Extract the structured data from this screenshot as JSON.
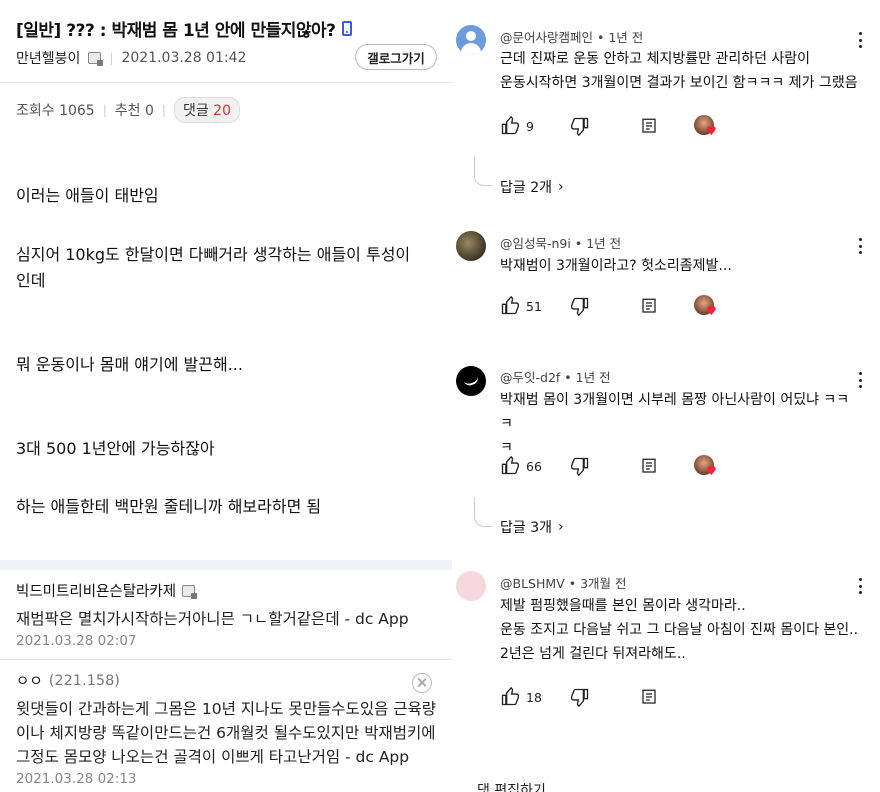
{
  "post": {
    "title": "[일반] ??? : 박재범 몸 1년 안에 만들지않아?",
    "author": "만년헬붕이",
    "date": "2021.03.28 01:42",
    "gallery_button": "갤로그가기",
    "views_label": "조회수 1065",
    "recommend_label": "추천 0",
    "replies_label": "댓글",
    "replies_count": "20",
    "body": [
      "이러는 애들이 태반임",
      "심지어 10kg도 한달이면 다빼거라 생각하는 애들이 투성이",
      "인데",
      "뭐 운동이나 몸매 얘기에 발끈해...",
      "3대 500 1년안에 가능하잖아",
      "하는 애들한테 백만원 줄테니까 해보라하면 됨"
    ]
  },
  "comments": [
    {
      "nick": "빅드미트리비욘슨탈라카제",
      "text": "재범팍은 멸치가시작하는거아니믄 ㄱㄴ할거같은데 - dc App",
      "date": "2021.03.28 02:07"
    },
    {
      "nick": "ㅇㅇ",
      "ip": "(221.158)",
      "text_lines": [
        "윗댓들이 간과하는게 그몸은 10년 지나도 못만들수도있음 근육량",
        "이나 체지방량 똑같이만드는건 6개월컷 될수도있지만 박재범키에",
        "그정도 몸모양 나오는건 골격이 이쁘게 타고난거임 - dc App"
      ],
      "date": "2021.03.28 02:13"
    }
  ],
  "yt_comments": [
    {
      "handle": "@문어사랑캠페인",
      "time": "1년 전",
      "lines": [
        "근데 진짜로 운동 안하고 체지방률만 관리하던 사람이",
        "운동시작하면 3개월이면 결과가 보이긴 함ㅋㅋㅋ 제가 그랬음"
      ],
      "likes": "9",
      "replies_link": "답글 2개"
    },
    {
      "handle": "@임성묵-n9i",
      "time": "1년 전",
      "lines": [
        "박재범이 3개월이라고? 헛소리좀제발..."
      ],
      "likes": "51"
    },
    {
      "handle": "@두잇-d2f",
      "time": "1년 전",
      "lines": [
        "박재범 몸이 3개월이면 시부레 몸짱 아닌사람이 어딨냐 ㅋㅋㅋ",
        "ㅋ"
      ],
      "likes": "66",
      "replies_link": "답글 3개"
    },
    {
      "handle": "@BLSHMV",
      "time": "3개월 전",
      "lines": [
        "제발 펌핑했을때를 본인 몸이라 생각마라..",
        "운동 조지고 다음날 쉬고 그 다음날 아침이 진짜 몸이다 본인..",
        "2년은 넘게 걸린다 뒤져라해도.."
      ],
      "likes": "18"
    }
  ],
  "bullet": "•",
  "chevron": "›",
  "cut_text": "댓 편집하기..",
  "colors": {
    "accent": "#d63232",
    "heart": "#ff1f3d",
    "band": "#eef2f8"
  }
}
